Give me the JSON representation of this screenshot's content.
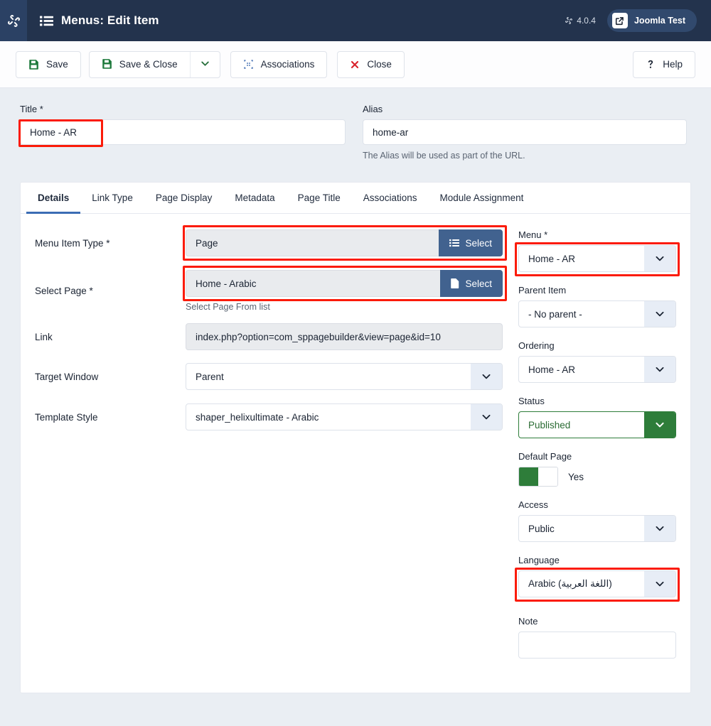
{
  "header": {
    "logo_icon": "joomla-logo-icon",
    "menu_icon": "list-icon",
    "title": "Menus: Edit Item",
    "version_icon": "joomla-icon",
    "version": "4.0.4",
    "user_icon": "external-link-icon",
    "user_label": "Joomla Test"
  },
  "toolbar": {
    "save_icon": "save-floppy-icon",
    "save_label": "Save",
    "save_close_icon": "save-floppy-icon",
    "save_close_label": "Save & Close",
    "save_close_caret_icon": "chevron-down-icon",
    "associations_icon": "associations-icon",
    "associations_label": "Associations",
    "close_icon": "x-close-icon",
    "close_label": "Close",
    "help_icon": "question-mark-icon",
    "help_label": "Help"
  },
  "top_fields": {
    "title_label": "Title *",
    "title_value": "Home - AR",
    "alias_label": "Alias",
    "alias_value": "home-ar",
    "alias_help": "The Alias will be used as part of the URL."
  },
  "tabs": [
    {
      "label": "Details",
      "active": true
    },
    {
      "label": "Link Type",
      "active": false
    },
    {
      "label": "Page Display",
      "active": false
    },
    {
      "label": "Metadata",
      "active": false
    },
    {
      "label": "Page Title",
      "active": false
    },
    {
      "label": "Associations",
      "active": false
    },
    {
      "label": "Module Assignment",
      "active": false
    }
  ],
  "details": {
    "menu_item_type_label": "Menu Item Type *",
    "menu_item_type_value": "Page",
    "menu_item_type_select_icon": "list-icon",
    "menu_item_type_select_label": "Select",
    "select_page_label": "Select Page *",
    "select_page_value": "Home - Arabic",
    "select_page_select_icon": "file-icon",
    "select_page_select_label": "Select",
    "select_page_help": "Select Page From list",
    "link_label": "Link",
    "link_value": "index.php?option=com_sppagebuilder&view=page&id=10",
    "target_window_label": "Target Window",
    "target_window_value": "Parent",
    "template_style_label": "Template Style",
    "template_style_value": "shaper_helixultimate - Arabic"
  },
  "sidebar": {
    "menu_label": "Menu *",
    "menu_value": "Home - AR",
    "parent_item_label": "Parent Item",
    "parent_item_value": "- No parent -",
    "ordering_label": "Ordering",
    "ordering_value": "Home - AR",
    "status_label": "Status",
    "status_value": "Published",
    "default_page_label": "Default Page",
    "default_page_value": "Yes",
    "access_label": "Access",
    "access_value": "Public",
    "language_label": "Language",
    "language_value": "Arabic (اللغة العربية)",
    "note_label": "Note",
    "note_value": "",
    "note_placeholder": ""
  },
  "colors": {
    "header_bg": "#23334d",
    "accent_blue": "#3b6cb4",
    "select_btn_blue": "#41628f",
    "status_green": "#2e7d3a",
    "annotation_red": "#fb1b09",
    "page_bg": "#eaeef3"
  }
}
